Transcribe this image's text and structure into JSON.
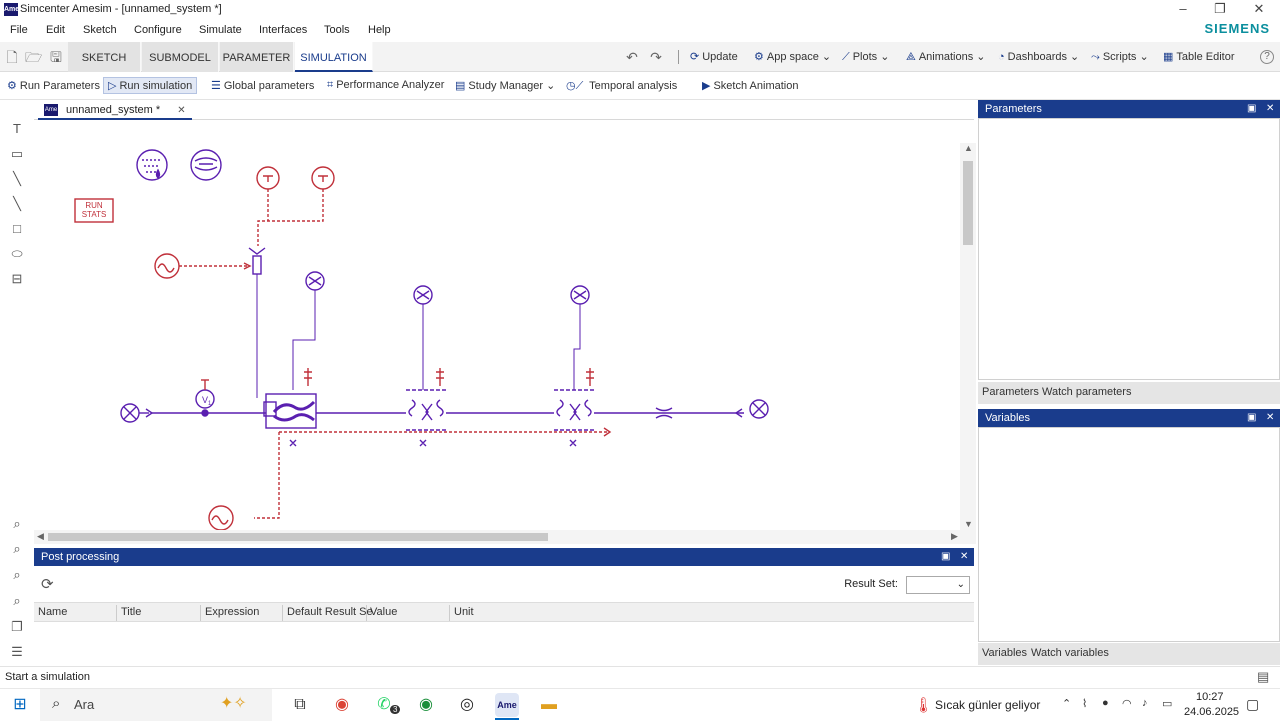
{
  "window": {
    "title": "Simcenter Amesim - [unnamed_system *]",
    "app_icon_text": "Ame",
    "controls": {
      "minimize": "–",
      "restore": "❐",
      "close": "✕"
    }
  },
  "menu": {
    "items": [
      "File",
      "Edit",
      "Sketch",
      "Configure",
      "Simulate",
      "Interfaces",
      "Tools",
      "Help"
    ],
    "brand": "SIEMENS"
  },
  "mode_tabs": [
    {
      "label": "SKETCH"
    },
    {
      "label": "SUBMODEL"
    },
    {
      "label": "PARAMETER"
    },
    {
      "label": "SIMULATION",
      "active": true
    }
  ],
  "toolbar": {
    "undo_icon": "↶",
    "redo_icon": "↷",
    "update": "Update",
    "app_space": "App space",
    "plots": "Plots",
    "animations": "Animations",
    "dashboards": "Dashboards",
    "scripts": "Scripts",
    "table_editor": "Table Editor",
    "help_icon": "?"
  },
  "sim_toolbar": {
    "run_parameters": "Run Parameters",
    "run_simulation": "Run simulation",
    "global_parameters": "Global parameters",
    "performance_analyzer": "Performance Analyzer",
    "study_manager": "Study Manager",
    "temporal_analysis": "Temporal analysis",
    "sketch_animation": "Sketch Animation"
  },
  "document_tab": {
    "label": "unnamed_system *",
    "icon_text": "Ame",
    "close": "✕"
  },
  "sketch": {
    "run_stats_label_1": "RUN",
    "run_stats_label_2": "STATS",
    "label_v1": "V",
    "label_v1_sub": "1"
  },
  "parameters_panel": {
    "title": "Parameters",
    "tabs": [
      "Parameters",
      "Watch parameters"
    ]
  },
  "variables_panel": {
    "title": "Variables",
    "tabs": [
      "Variables",
      "Watch variables"
    ]
  },
  "post_processing": {
    "title": "Post processing",
    "result_set_label": "Result Set:",
    "result_set_value": "",
    "columns": [
      "Name",
      "Title",
      "Expression",
      "Default Result Se",
      "Value",
      "Unit"
    ]
  },
  "status_bar": {
    "text": "Start a simulation"
  },
  "taskbar": {
    "search_text": "Ara",
    "weather_text": "Sıcak günler geliyor",
    "time": "10:27",
    "date": "24.06.2025",
    "whatsapp_badge": "3"
  },
  "colors": {
    "accent": "#1a3c8c",
    "sketch_purple": "#5a1fb0",
    "sketch_red": "#c0303a"
  }
}
